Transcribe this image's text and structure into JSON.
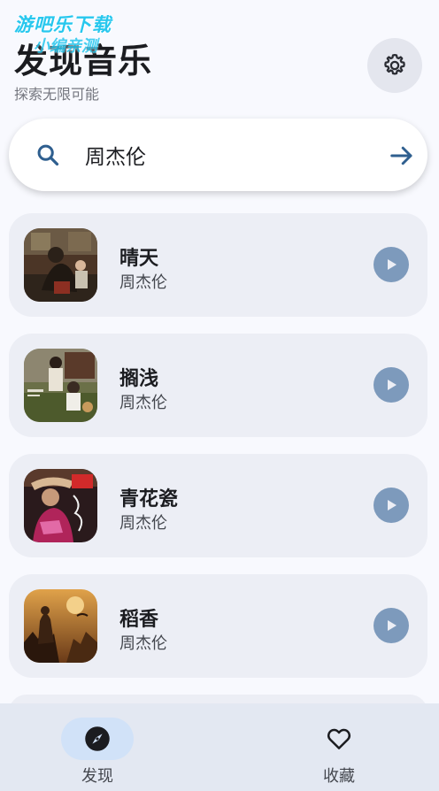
{
  "watermark": {
    "line1": "游吧乐下载",
    "line2": "小编亲测"
  },
  "header": {
    "title": "发现音乐",
    "subtitle": "探索无限可能",
    "settings_icon": "gear-icon"
  },
  "search": {
    "value": "周杰伦",
    "placeholder": "",
    "icon": "search-icon",
    "submit_icon": "arrow-right-icon"
  },
  "songs": [
    {
      "title": "晴天",
      "artist": "周杰伦"
    },
    {
      "title": "搁浅",
      "artist": "周杰伦"
    },
    {
      "title": "青花瓷",
      "artist": "周杰伦"
    },
    {
      "title": "稻香",
      "artist": "周杰伦"
    }
  ],
  "bottom_nav": {
    "items": [
      {
        "label": "发现",
        "icon": "compass-icon",
        "active": true
      },
      {
        "label": "收藏",
        "icon": "heart-icon",
        "active": false
      }
    ]
  },
  "colors": {
    "background": "#f8f9fe",
    "card": "#eceef5",
    "play_button": "#7d9abc",
    "accent": "#2f5f8f",
    "nav_active_pill": "#d1e2f8",
    "nav_bar": "#e3e8f2"
  }
}
